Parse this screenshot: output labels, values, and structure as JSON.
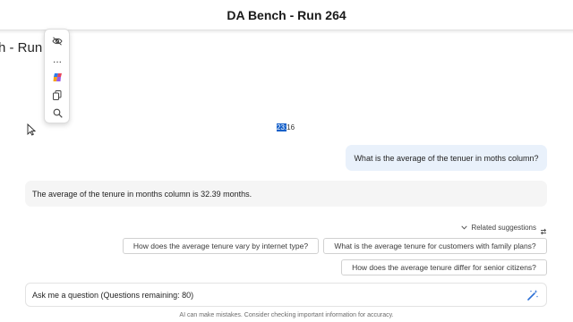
{
  "window": {
    "title": "DA Bench - Run 264"
  },
  "page": {
    "title_partial": "h - Run 2"
  },
  "toolbar": {
    "items": [
      {
        "icon": "eye-off-icon"
      },
      {
        "icon": "more-icon",
        "glyph": "..."
      },
      {
        "icon": "copilot-icon"
      },
      {
        "icon": "copy-icon"
      },
      {
        "icon": "search-icon"
      }
    ]
  },
  "chat": {
    "timestamp_highlight": "23:",
    "timestamp_rest": "16",
    "user_message": "What is the average of the tenuer in moths column?",
    "ai_message": "The average of the tenure in months column is 32.39 months."
  },
  "related": {
    "label": "Related suggestions",
    "suggestions": [
      "How does the average tenure vary by internet type?",
      "What is the average tenure for customers with family plans?",
      "How does the average tenure differ for senior citizens?"
    ]
  },
  "input": {
    "placeholder": "Ask me a question (Questions remaining: 80)"
  },
  "footer": {
    "disclaimer": "AI can make mistakes. Consider checking important information for accuracy."
  },
  "colors": {
    "accent": "#1560c9",
    "user_bubble": "#e9f1fb",
    "ai_bubble": "#f5f5f5"
  }
}
